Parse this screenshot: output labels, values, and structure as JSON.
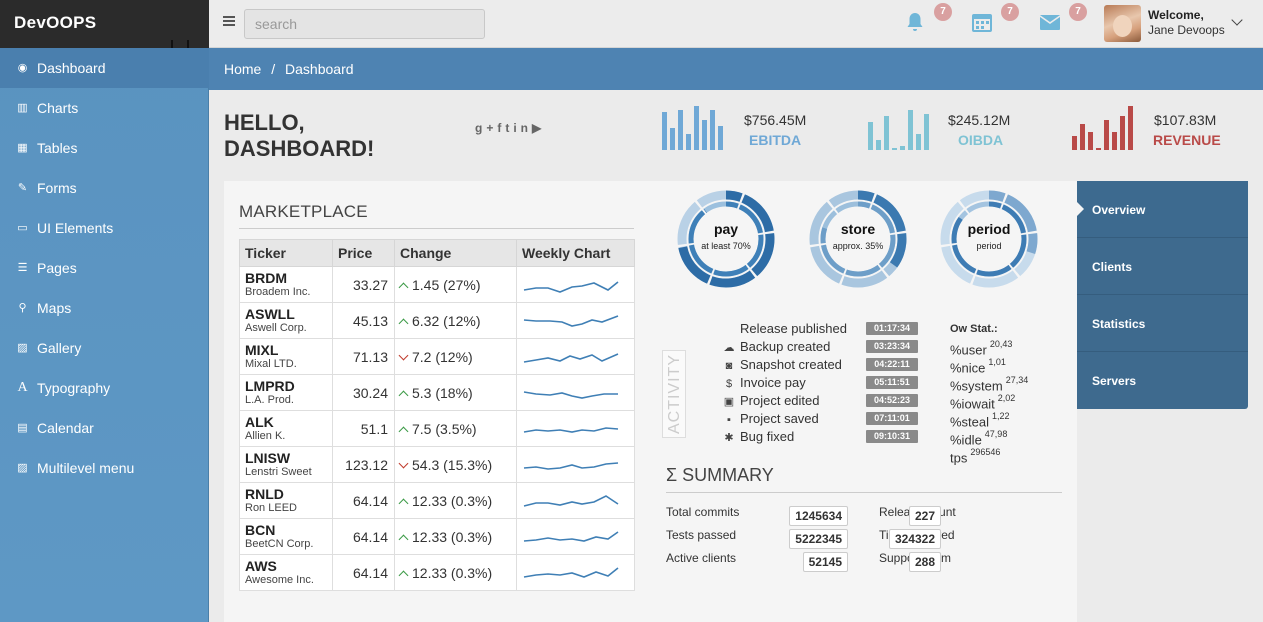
{
  "app": {
    "logo": "DevOOPS"
  },
  "topbar": {
    "search_placeholder": "search",
    "notifications": [
      {
        "icon": "bell-icon",
        "count": "7"
      },
      {
        "icon": "calendar-icon",
        "count": "7"
      },
      {
        "icon": "envelope-icon",
        "count": "7"
      }
    ],
    "user": {
      "greeting": "Welcome,",
      "name": "Jane Devoops"
    }
  },
  "sidebar": {
    "items": [
      {
        "label": "Dashboard",
        "icon": "dashboard-icon",
        "active": true
      },
      {
        "label": "Charts",
        "icon": "bar-chart-icon"
      },
      {
        "label": "Tables",
        "icon": "table-icon"
      },
      {
        "label": "Forms",
        "icon": "edit-icon"
      },
      {
        "label": "UI Elements",
        "icon": "desktop-icon"
      },
      {
        "label": "Pages",
        "icon": "list-icon"
      },
      {
        "label": "Maps",
        "icon": "map-marker-icon"
      },
      {
        "label": "Gallery",
        "icon": "picture-icon"
      },
      {
        "label": "Typography",
        "icon": "font-icon"
      },
      {
        "label": "Calendar",
        "icon": "calendar-icon"
      },
      {
        "label": "Multilevel menu",
        "icon": "picture-icon"
      }
    ]
  },
  "breadcrumb": {
    "home": "Home",
    "sep": "/",
    "current": "Dashboard"
  },
  "hello": {
    "line1": "HELLO,",
    "line2": "DASHBOARD!",
    "social": "g+ f t in yt"
  },
  "stats": [
    {
      "value": "$756.45M",
      "label": "EBITDA",
      "color": "#6fa8d6"
    },
    {
      "value": "$245.12M",
      "label": "OIBDA",
      "color": "#7fc3d4"
    },
    {
      "value": "$107.83M",
      "label": "REVENUE",
      "color": "#b94a48"
    }
  ],
  "marketplace": {
    "title": "MARKETPLACE",
    "columns": [
      "Ticker",
      "Price",
      "Change",
      "Weekly Chart"
    ],
    "rows": [
      {
        "ticker": "BRDM",
        "company": "Broadem Inc.",
        "price": "33.27",
        "dir": "up",
        "change": "1.45 (27%)"
      },
      {
        "ticker": "ASWLL",
        "company": "Aswell Corp.",
        "price": "45.13",
        "dir": "up",
        "change": "6.32 (12%)"
      },
      {
        "ticker": "MIXL",
        "company": "Mixal LTD.",
        "price": "71.13",
        "dir": "down",
        "change": "7.2 (12%)"
      },
      {
        "ticker": "LMPRD",
        "company": "L.A. Prod.",
        "price": "30.24",
        "dir": "up",
        "change": "5.3 (18%)"
      },
      {
        "ticker": "ALK",
        "company": "Allien K.",
        "price": "51.1",
        "dir": "up",
        "change": "7.5 (3.5%)"
      },
      {
        "ticker": "LNISW",
        "company": "Lenstri Sweet",
        "price": "123.12",
        "dir": "down",
        "change": "54.3 (15.3%)"
      },
      {
        "ticker": "RNLD",
        "company": "Ron LEED",
        "price": "64.14",
        "dir": "up",
        "change": "12.33 (0.3%)"
      },
      {
        "ticker": "BCN",
        "company": "BeetCN Corp.",
        "price": "64.14",
        "dir": "up",
        "change": "12.33 (0.3%)"
      },
      {
        "ticker": "AWS",
        "company": "Awesome Inc.",
        "price": "64.14",
        "dir": "up",
        "change": "12.33 (0.3%)"
      }
    ]
  },
  "donuts": [
    {
      "title": "pay",
      "sub": "at least 70%",
      "color": "#2f6fa8"
    },
    {
      "title": "store",
      "sub": "approx. 35%",
      "color": "#4e86b6"
    },
    {
      "title": "period",
      "sub": "period",
      "color": "#6a9bc6"
    }
  ],
  "activity": {
    "tab_label": "ACTIVITY",
    "items": [
      {
        "icon": "code-icon",
        "label": "Release published",
        "time": "01:17:34"
      },
      {
        "icon": "cloud-upload-icon",
        "label": "Backup created",
        "time": "03:23:34"
      },
      {
        "icon": "camera-icon",
        "label": "Snapshot created",
        "time": "04:22:11"
      },
      {
        "icon": "dollar-icon",
        "label": "Invoice pay",
        "time": "05:11:51"
      },
      {
        "icon": "briefcase-icon",
        "label": "Project edited",
        "time": "04:52:23"
      },
      {
        "icon": "floppy-icon",
        "label": "Project saved",
        "time": "07:11:01"
      },
      {
        "icon": "bug-icon",
        "label": "Bug fixed",
        "time": "09:10:31"
      }
    ]
  },
  "ow_stat": {
    "title": "Ow Stat.:",
    "rows": [
      {
        "label": "%user",
        "value": "20,43"
      },
      {
        "label": "%nice",
        "value": "1,01"
      },
      {
        "label": "%system",
        "value": "27,34"
      },
      {
        "label": "%iowait",
        "value": "2,02"
      },
      {
        "label": "%steal",
        "value": "1,22"
      },
      {
        "label": "%idle",
        "value": "47,98"
      },
      {
        "label": "tps",
        "value": "296546"
      }
    ]
  },
  "summary": {
    "title": "Σ SUMMARY",
    "left": [
      {
        "label": "Total commits",
        "value": "1245634"
      },
      {
        "label": "Tests passed",
        "value": "5222345"
      },
      {
        "label": "Active clients",
        "value": "52145"
      }
    ],
    "right": [
      {
        "label": "Release count",
        "value": "227"
      },
      {
        "label": "Tickets solved",
        "value": "324322"
      },
      {
        "label": "Support team",
        "value": "288"
      }
    ]
  },
  "right_tabs": [
    {
      "label": "Overview",
      "active": true
    },
    {
      "label": "Clients"
    },
    {
      "label": "Statistics"
    },
    {
      "label": "Servers"
    }
  ]
}
